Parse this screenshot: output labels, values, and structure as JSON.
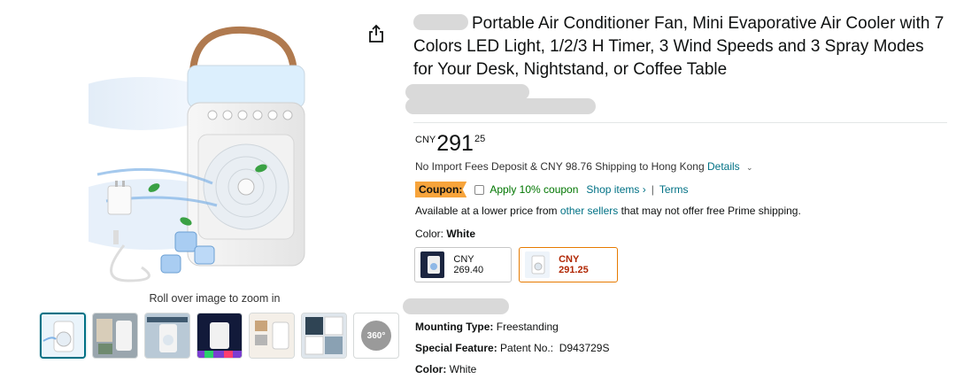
{
  "gallery": {
    "zoom_hint": "Roll over image to zoom in",
    "badge_360": "360°",
    "thumbnail_count": 7
  },
  "product": {
    "title": "Portable Air Conditioner Fan, Mini Evaporative Air Cooler with 7 Colors LED Light, 1/2/3 H Timer, 3 Wind Speeds and 3 Spray Modes for Your Desk, Nightstand, or Coffee Table",
    "price": {
      "currency": "CNY",
      "whole": "291",
      "fraction": "25"
    },
    "shipping": {
      "text": "No Import Fees Deposit & CNY 98.76 Shipping to Hong Kong",
      "details_link": "Details"
    },
    "coupon": {
      "badge": "Coupon:",
      "apply": "Apply 10% coupon",
      "shop_items": "Shop items ›",
      "separator": "|",
      "terms": "Terms"
    },
    "lower_price": {
      "prefix": "Available at a lower price from",
      "link": "other sellers",
      "suffix": "that may not offer free Prime shipping."
    },
    "color": {
      "label": "Color:",
      "value": "White"
    },
    "options": [
      {
        "price": "CNY 269.40",
        "selected": false
      },
      {
        "price": "CNY 291.25",
        "selected": true
      }
    ],
    "specs": [
      {
        "label": "Mounting Type:",
        "value": "Freestanding"
      },
      {
        "label": "Special Feature:",
        "value": "Patent No.:  D943729S"
      },
      {
        "label": "Color:",
        "value": "White"
      }
    ]
  },
  "colors": {
    "link": "#007185",
    "price_red": "#b12704",
    "coupon": "#f7a43b",
    "selected_border": "#e67a00"
  }
}
